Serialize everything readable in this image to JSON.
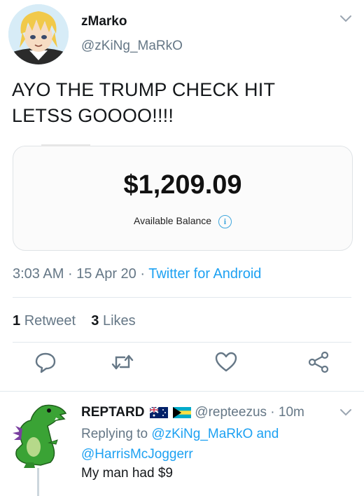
{
  "tweet": {
    "author_name": "zMarko",
    "author_handle": "@zKiNg_MaRkO",
    "text_line1": "AYO THE TRUMP CHECK HIT",
    "text_line2": "LETSS GOOOO!!!!",
    "card": {
      "amount": "$1,209.09",
      "label": "Available Balance",
      "info_glyph": "i"
    },
    "time": "3:03 AM",
    "sep1": " · ",
    "date": "15 Apr 20",
    "sep2": " · ",
    "source": "Twitter for Android",
    "retweet_count": "1",
    "retweet_label": "Retweet",
    "like_count": "3",
    "like_label": "Likes"
  },
  "actions": {
    "icons": [
      "reply-icon",
      "retweet-icon",
      "like-icon",
      "share-icon"
    ]
  },
  "reply": {
    "author_name": "REPTARD",
    "author_handle": "@repteezus",
    "sep": " · ",
    "time": "10m",
    "replying_prefix": "Replying to ",
    "mention1": "@zKiNg_MaRkO",
    "and": " and",
    "mention2": "@HarrisMcJoggerr",
    "text": "My man had $9"
  },
  "colors": {
    "link": "#1da1f2",
    "muted": "#657786",
    "text": "#14171a",
    "divider": "#e1e8ed"
  }
}
